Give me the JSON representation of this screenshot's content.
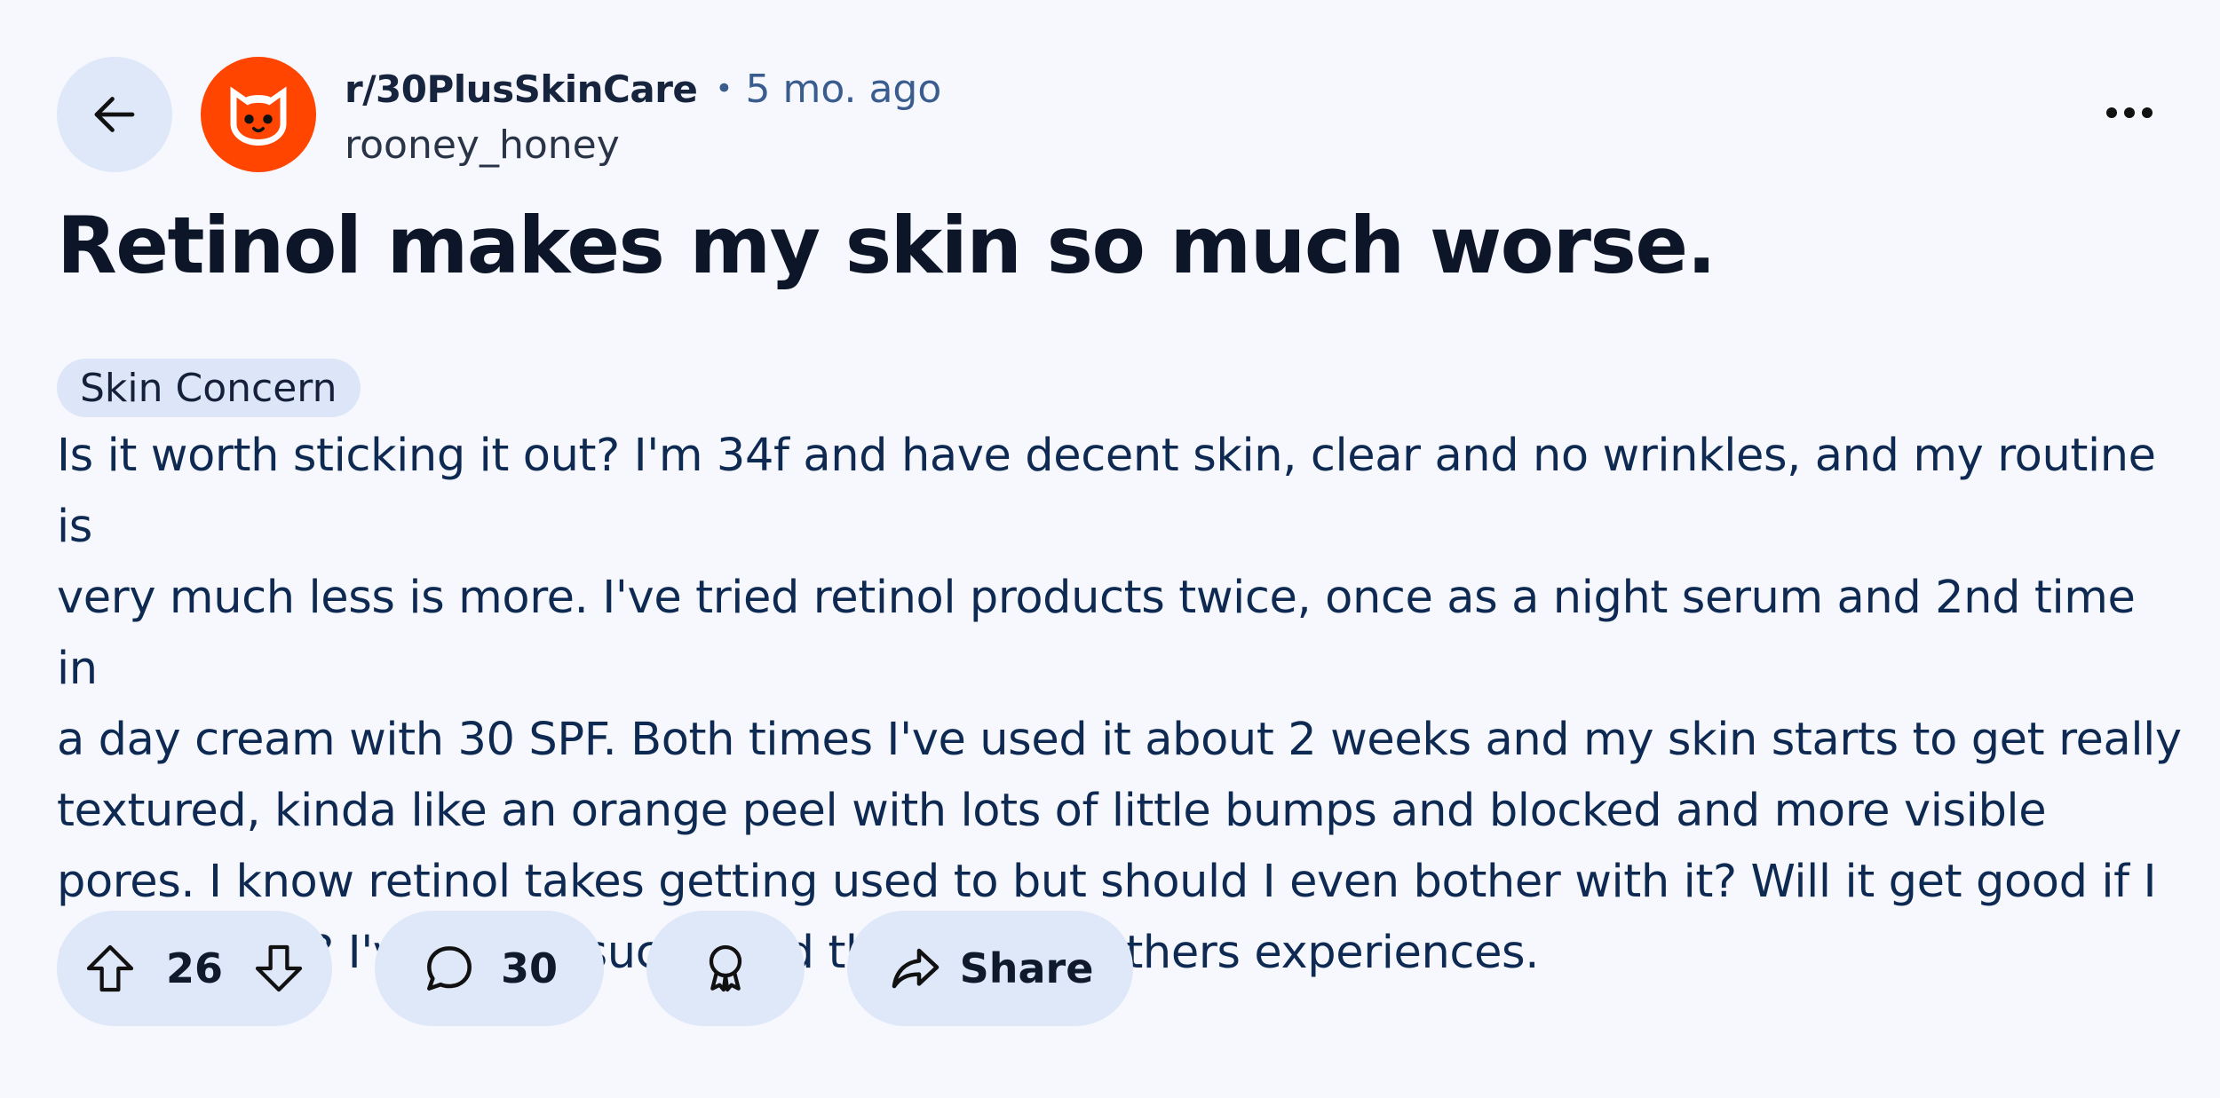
{
  "post": {
    "subreddit": "r/30PlusSkinCare",
    "separator": "•",
    "age": "5 mo. ago",
    "author": "rooney_honey",
    "title": "Retinol makes my skin so much worse.",
    "flair": "Skin Concern",
    "body_lines": [
      "Is it worth sticking it out? I'm 34f and have decent skin, clear and no wrinkles, and my routine is",
      "very much less is more. I've tried retinol products twice, once as a night serum and 2nd time in",
      "a day cream with 30 SPF. Both times I've used it about 2 weeks and my skin starts to get really",
      "textured, kinda like an orange peel with lots of little bumps and blocked and more visible",
      "pores. I know retinol takes getting used to but should I even bother with it? Will it get good if I",
      "give it time? I've heard such good things from others experiences."
    ]
  },
  "actions": {
    "vote_count": "26",
    "comment_count": "30",
    "share_label": "Share"
  },
  "icons": {
    "back": "arrow-left-icon",
    "avatar": "cat-face-icon",
    "more": "ellipsis-icon",
    "upvote": "arrow-up-icon",
    "downvote": "arrow-down-icon",
    "comment": "speech-bubble-icon",
    "award": "award-ribbon-icon",
    "share": "share-arrow-icon"
  },
  "colors": {
    "background": "#f6f8fd",
    "pill": "#dfe8f8",
    "avatar": "#ff4500",
    "meta_accent": "#3a5c8e",
    "title": "#0d1628",
    "body_text": "#0f2a52"
  }
}
